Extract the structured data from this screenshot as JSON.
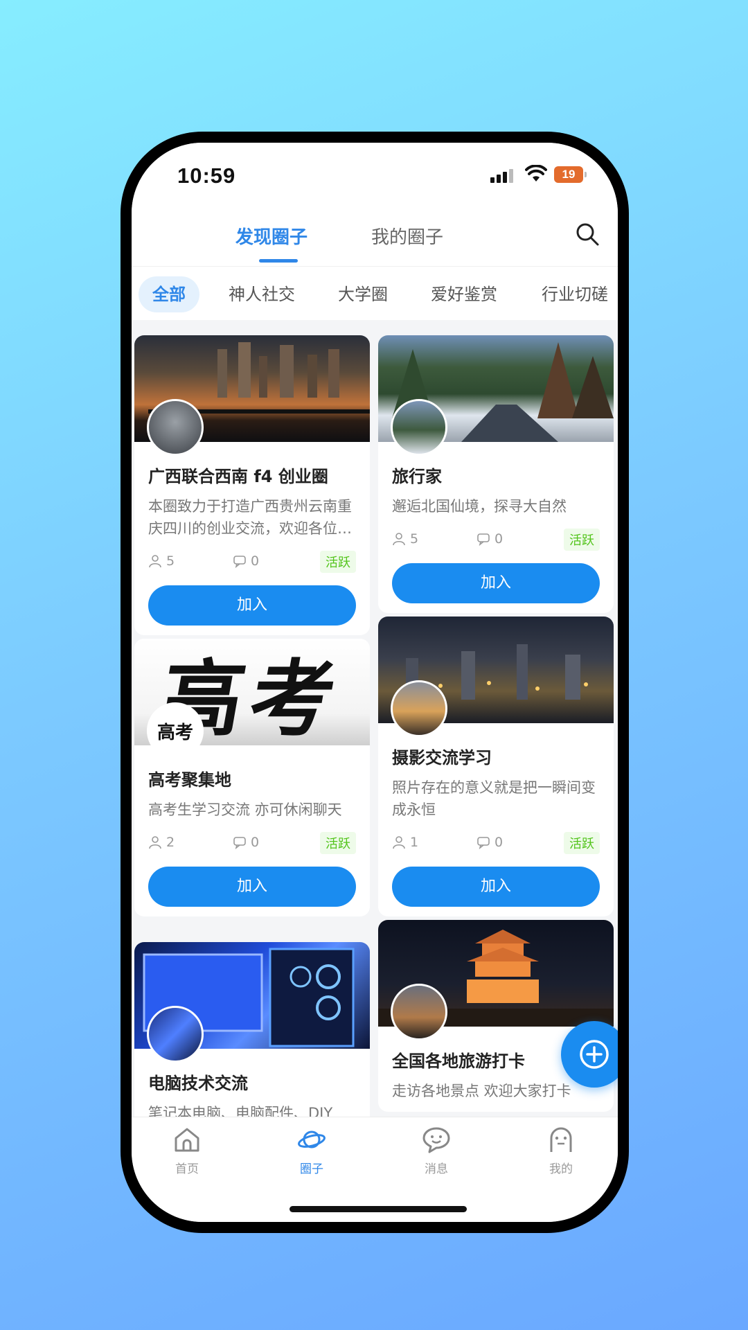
{
  "status": {
    "time": "10:59",
    "battery": "19"
  },
  "header": {
    "tabs": [
      {
        "label": "发现圈子",
        "active": true
      },
      {
        "label": "我的圈子",
        "active": false
      }
    ]
  },
  "categories": [
    "全部",
    "神人社交",
    "大学圈",
    "爱好鉴赏",
    "行业切磋"
  ],
  "cards": [
    {
      "title": "广西联合西南 f4 创业圈",
      "desc": "本圈致力于打造广西贵州云南重庆四川的创业交流，欢迎各位加入",
      "members": "5",
      "posts": "0",
      "badge": "活跃",
      "join": "加入"
    },
    {
      "title": "旅行家",
      "desc": "邂逅北国仙境，探寻大自然",
      "members": "5",
      "posts": "0",
      "badge": "活跃",
      "join": "加入"
    },
    {
      "title": "高考聚集地",
      "desc": "高考生学习交流 亦可休闲聊天",
      "members": "2",
      "posts": "0",
      "badge": "活跃",
      "join": "加入",
      "image_text": "高考"
    },
    {
      "title": "摄影交流学习",
      "desc": "照片存在的意义就是把一瞬间变成永恒",
      "members": "1",
      "posts": "0",
      "badge": "活跃",
      "join": "加入"
    },
    {
      "title": "电脑技术交流",
      "desc": "笔记本电脑、电脑配件、DIY"
    },
    {
      "title": "全国各地旅游打卡",
      "desc": "走访各地景点 欢迎大家打卡"
    }
  ],
  "bottom_nav": [
    {
      "label": "首页",
      "icon": "home-icon"
    },
    {
      "label": "圈子",
      "icon": "planet-icon",
      "active": true
    },
    {
      "label": "消息",
      "icon": "message-icon"
    },
    {
      "label": "我的",
      "icon": "profile-icon"
    }
  ],
  "colors": {
    "accent": "#1a8cf0",
    "active_tab": "#2f87e8",
    "badge_green": "#52c41a"
  }
}
